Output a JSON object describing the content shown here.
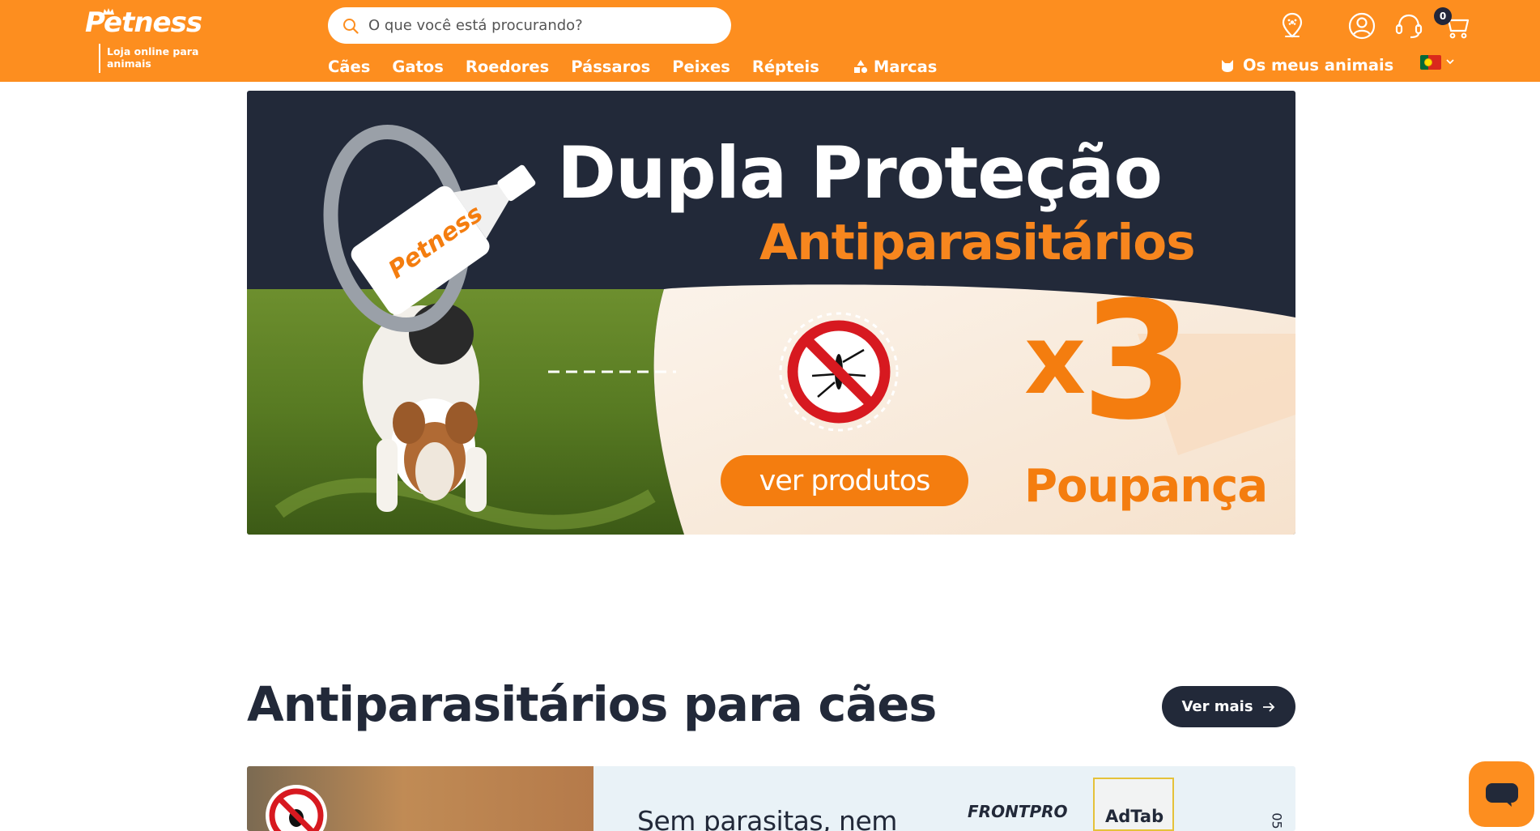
{
  "header": {
    "logo_text": "Petness",
    "logo_tagline": "Loja online para animais",
    "search_placeholder": "O que você está procurando?",
    "nav": [
      "Cães",
      "Gatos",
      "Roedores",
      "Pássaros",
      "Peixes",
      "Répteis"
    ],
    "brands_label": "Marcas",
    "my_pets_label": "Os meus animais",
    "cart_count": "0",
    "icons": [
      "store-location-icon",
      "account-icon",
      "support-headset-icon",
      "cart-icon"
    ]
  },
  "hero": {
    "title": "Dupla Proteção",
    "subtitle": "Antiparasitários",
    "cta": "ver produtos",
    "multiplier_prefix": "x",
    "multiplier_value": "3",
    "saving_label": "Poupança",
    "product_brand": "Petness"
  },
  "section": {
    "title": "Antiparasitários para cães",
    "see_more": "Ver mais"
  },
  "promo": {
    "text": "Sem parasitas, nem",
    "brand_a": "FRONTPRO",
    "brand_b": "AdTab",
    "side_text": "05"
  },
  "colors": {
    "brand_orange": "#fd8e1f",
    "navy": "#222939",
    "accent_orange": "#f47d0f"
  }
}
